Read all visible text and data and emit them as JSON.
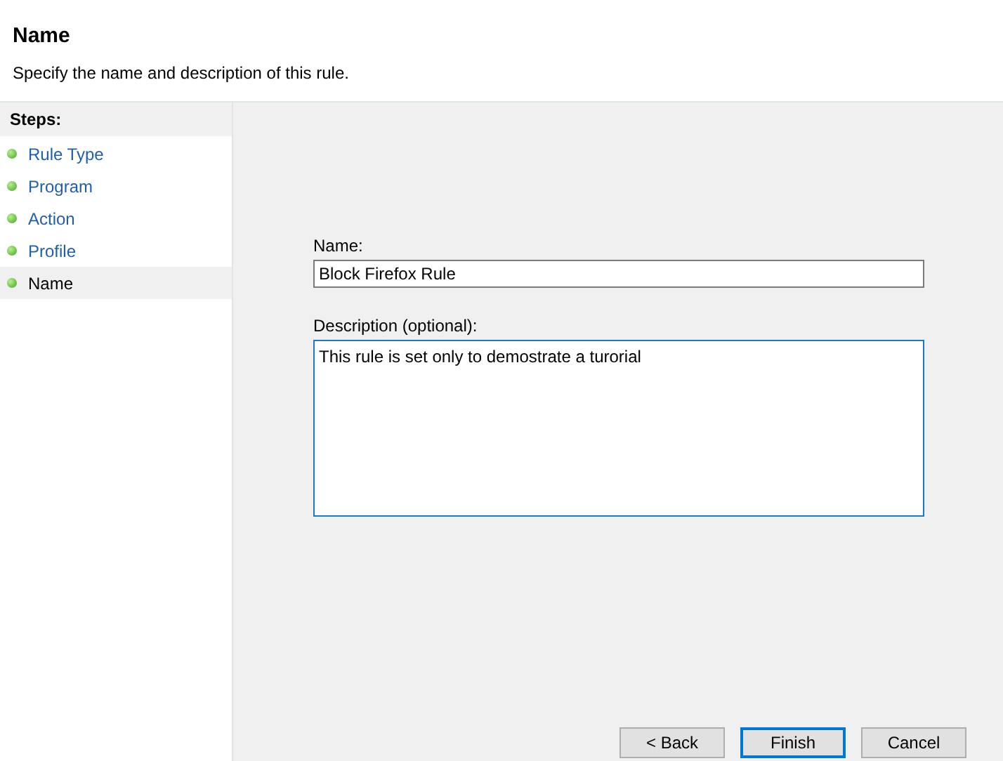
{
  "header": {
    "title": "Name",
    "subtitle": "Specify the name and description of this rule."
  },
  "steps": {
    "heading": "Steps:",
    "items": [
      {
        "label": "Rule Type",
        "selected": false
      },
      {
        "label": "Program",
        "selected": false
      },
      {
        "label": "Action",
        "selected": false
      },
      {
        "label": "Profile",
        "selected": false
      },
      {
        "label": "Name",
        "selected": true
      }
    ]
  },
  "form": {
    "name_label": "Name:",
    "name_value": "Block Firefox Rule",
    "description_label": "Description (optional):",
    "description_value": "This rule is set only to demostrate a turorial"
  },
  "buttons": [
    {
      "label": "< Back",
      "default": false
    },
    {
      "label": "Finish",
      "default": true
    },
    {
      "label": "Cancel",
      "default": false
    }
  ]
}
